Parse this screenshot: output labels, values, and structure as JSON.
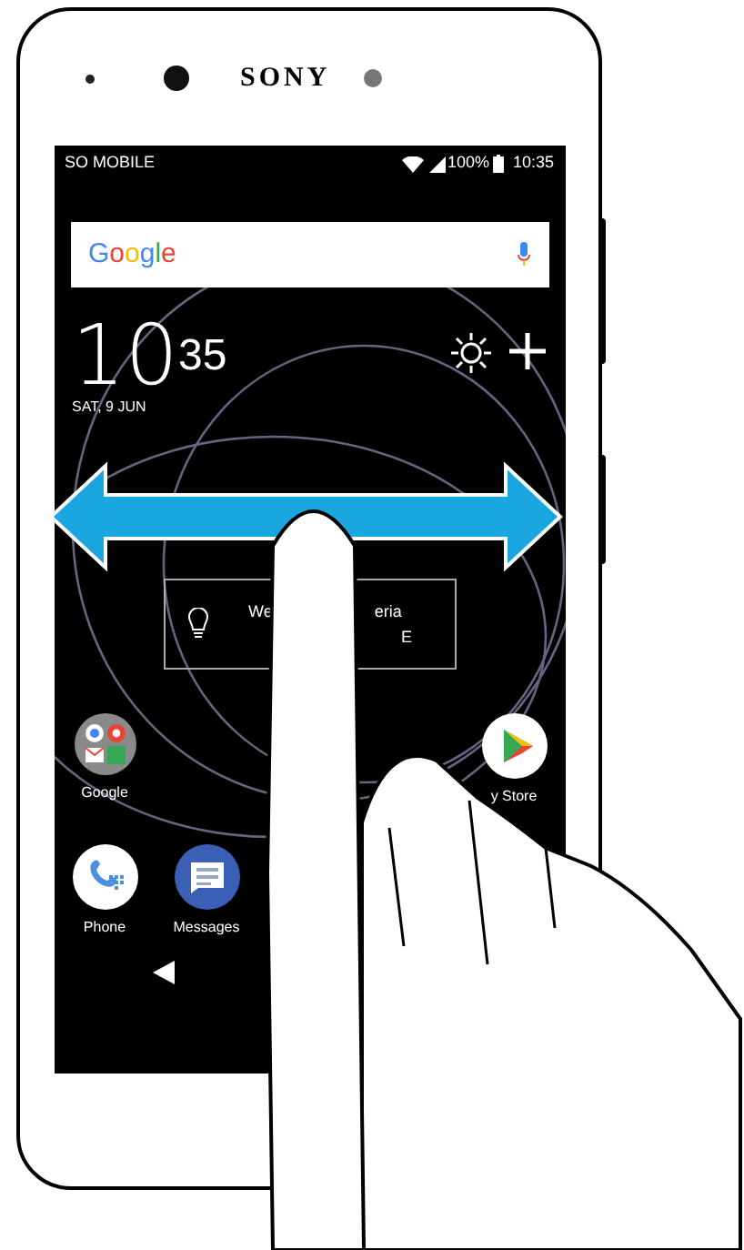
{
  "device": {
    "brand": "SONY"
  },
  "status_bar": {
    "carrier": "SO MOBILE",
    "battery": "100%",
    "time": "10:35"
  },
  "search_bar": {
    "logo": "Google"
  },
  "clock_widget": {
    "hours": "10",
    "minutes": "35",
    "date": "SAT, 9 JUN"
  },
  "tip_widget": {
    "text_left": "We",
    "text_right": "eria",
    "line_2": "E"
  },
  "apps": [
    {
      "kind": "folder",
      "label": "Google"
    },
    {
      "kind": "store",
      "label": "y Store"
    }
  ],
  "dock": [
    {
      "kind": "phone",
      "label": "Phone"
    },
    {
      "kind": "messages",
      "label": "Messages"
    }
  ]
}
